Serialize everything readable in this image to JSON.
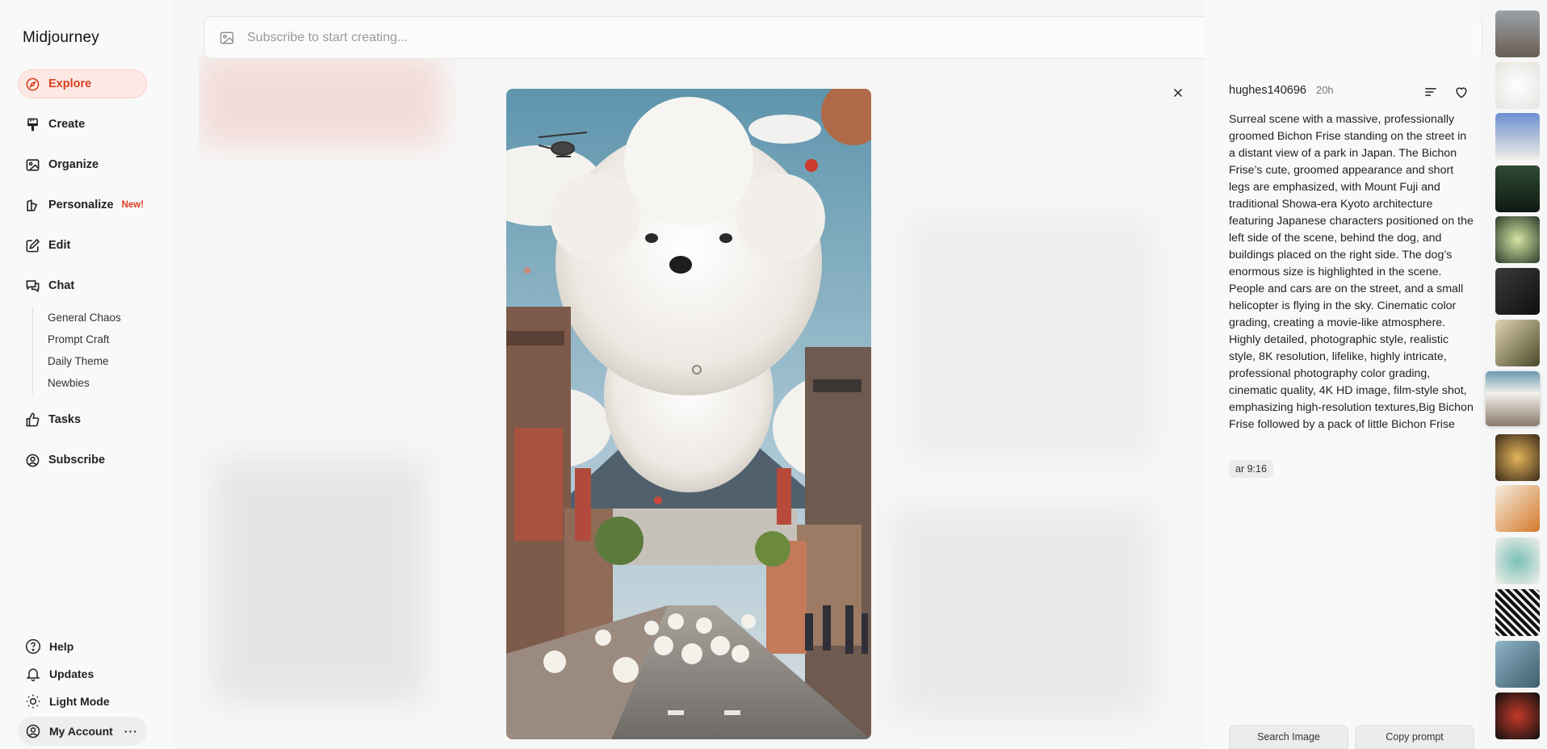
{
  "app": {
    "title": "Midjourney"
  },
  "sidebar": {
    "items": [
      {
        "label": "Explore",
        "icon": "compass-icon",
        "active": true
      },
      {
        "label": "Create",
        "icon": "brush-icon"
      },
      {
        "label": "Organize",
        "icon": "image-icon"
      },
      {
        "label": "Personalize",
        "icon": "personalize-icon",
        "badge": "New!"
      },
      {
        "label": "Edit",
        "icon": "edit-icon"
      },
      {
        "label": "Chat",
        "icon": "chat-icon"
      }
    ],
    "chat_channels": [
      "General Chaos",
      "Prompt Craft",
      "Daily Theme",
      "Newbies"
    ],
    "items_after": [
      {
        "label": "Tasks",
        "icon": "thumbs-up-icon"
      },
      {
        "label": "Subscribe",
        "icon": "user-circle-icon"
      }
    ],
    "bottom": [
      {
        "label": "Help",
        "icon": "help-icon"
      },
      {
        "label": "Updates",
        "icon": "bell-icon"
      },
      {
        "label": "Light Mode",
        "icon": "sun-icon"
      }
    ],
    "account": {
      "label": "My Account",
      "more": "···"
    }
  },
  "search": {
    "placeholder": "Subscribe to start creating..."
  },
  "detail": {
    "author": "hughes140696",
    "time": "20h",
    "prompt": "Surreal scene with a massive, professionally groomed Bichon Frise standing on the street in a distant view of a park in Japan. The Bichon Frise’s cute, groomed appearance and short legs are emphasized, with Mount Fuji and traditional Showa-era Kyoto architecture featuring Japanese characters positioned on the left side of the scene, behind the dog, and buildings placed on the right side. The dog’s enormous size is highlighted in the scene. People and cars are on the street, and a small helicopter is flying in the sky. Cinematic color grading, creating a movie-like atmosphere. Highly detailed, photographic style, realistic style, 8K resolution, lifelike, highly intricate, professional photography color grading, cinematic quality, 4K HD image, film-style shot, emphasizing high-resolution textures,Big Bichon Frise followed by a pack of little Bichon Frise",
    "param": "ar 9:16",
    "buttons": {
      "search_image": "Search Image",
      "copy_prompt": "Copy prompt"
    }
  },
  "colors": {
    "accent": "#d9401f",
    "accent_bg": "#fde8e4"
  }
}
